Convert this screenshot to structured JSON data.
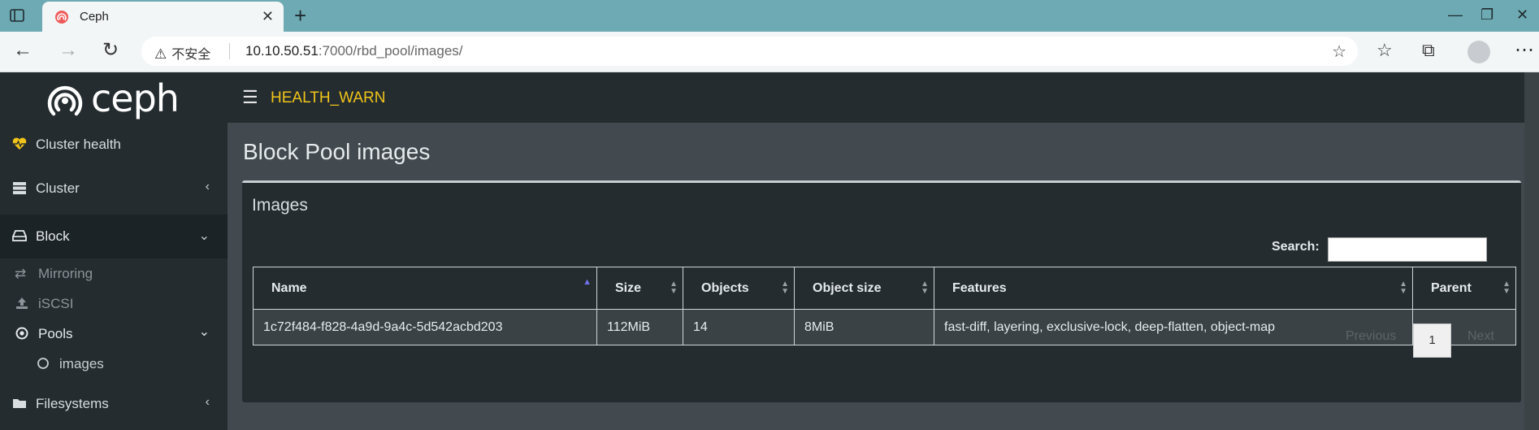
{
  "browser": {
    "tab_title": "Ceph",
    "insecure_label": "不安全",
    "url_host": "10.10.50.51",
    "url_rest": ":7000/rbd_pool/images/"
  },
  "app": {
    "brand": "ceph",
    "health_status": "HEALTH_WARN",
    "health_color": "#f0c419"
  },
  "sidebar": {
    "items": [
      {
        "label": "Cluster health",
        "icon": "heartbeat-icon"
      },
      {
        "label": "Cluster",
        "icon": "server-icon"
      },
      {
        "label": "Block",
        "icon": "drive-icon"
      },
      {
        "label": "Filesystems",
        "icon": "folder-icon"
      }
    ],
    "block_sub": [
      {
        "label": "Mirroring",
        "icon": "exchange-icon"
      },
      {
        "label": "iSCSI",
        "icon": "upload-icon"
      },
      {
        "label": "Pools",
        "icon": "dot-circle-icon"
      },
      {
        "label": "images",
        "icon": "circle-icon"
      }
    ]
  },
  "main": {
    "page_title": "Block Pool images",
    "panel_title": "Images",
    "search_label": "Search:",
    "search_value": "",
    "columns": [
      "Name",
      "Size",
      "Objects",
      "Object size",
      "Features",
      "Parent"
    ],
    "rows": [
      {
        "name": "1c72f484-f828-4a9d-9a4c-5d542acbd203",
        "size": "112MiB",
        "objects": "14",
        "object_size": "8MiB",
        "features": "fast-diff, layering, exclusive-lock, deep-flatten, object-map",
        "parent": ""
      }
    ],
    "pager": {
      "previous": "Previous",
      "page": "1",
      "next": "Next"
    }
  }
}
